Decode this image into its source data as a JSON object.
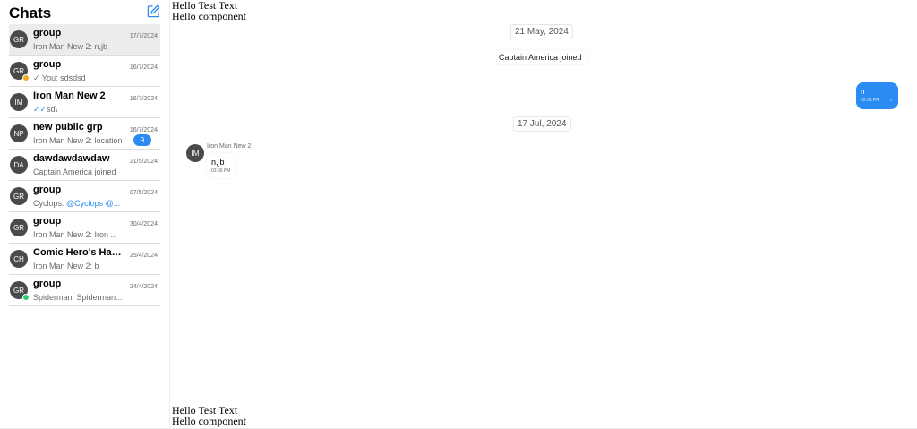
{
  "sidebar": {
    "title": "Chats",
    "compose_icon": "compose-icon",
    "items": [
      {
        "initials": "GR",
        "name": "group",
        "preview": "Iron Man New 2: n,jb",
        "date": "17/7/2024",
        "active": true
      },
      {
        "initials": "GR",
        "name": "group",
        "preview": "You: sdsdsd",
        "date": "16/7/2024",
        "tick": "single",
        "status_color": "#f5a623"
      },
      {
        "initials": "IM",
        "name": "Iron Man New 2",
        "preview": "sd\\",
        "date": "16/7/2024",
        "tick": "double"
      },
      {
        "initials": "NP",
        "name": "new public grp",
        "preview": "Iron Man New 2: location",
        "date": "16/7/2024",
        "badge": "9"
      },
      {
        "initials": "DA",
        "name": "dawdawdawdaw",
        "preview": "Captain America joined",
        "date": "21/5/2024"
      },
      {
        "initials": "GR",
        "name": "group",
        "preview_prefix": "Cyclops: ",
        "preview_mention": "@Cyclops @...",
        "date": "07/5/2024"
      },
      {
        "initials": "GR",
        "name": "group",
        "preview": "Iron Man New 2: Iron ...",
        "date": "30/4/2024"
      },
      {
        "initials": "CH",
        "name": "Comic Hero's Han...",
        "preview": "Iron Man New 2: b",
        "date": "25/4/2024"
      },
      {
        "initials": "GR",
        "name": "group",
        "preview": "Spiderman: Spiderman...",
        "date": "24/4/2024",
        "status_color": "#2ecc71"
      }
    ]
  },
  "main": {
    "top_banner_line1": "Hello Test Text",
    "top_banner_line2": "Hello component",
    "bottom_banner_line1": "Hello Test Text",
    "bottom_banner_line2": "Hello component",
    "date_1": "21 May, 2024",
    "system_msg": "Captain America joined",
    "outgoing": {
      "text": "n",
      "time": "03:39 PM"
    },
    "date_2": "17 Jul, 2024",
    "incoming": {
      "initials": "IM",
      "sender": "Iron Man New 2",
      "text": "n,jb",
      "time": "03:36 PM"
    }
  },
  "colors": {
    "accent": "#2a8bf2",
    "avatar": "#4a4a4a"
  }
}
